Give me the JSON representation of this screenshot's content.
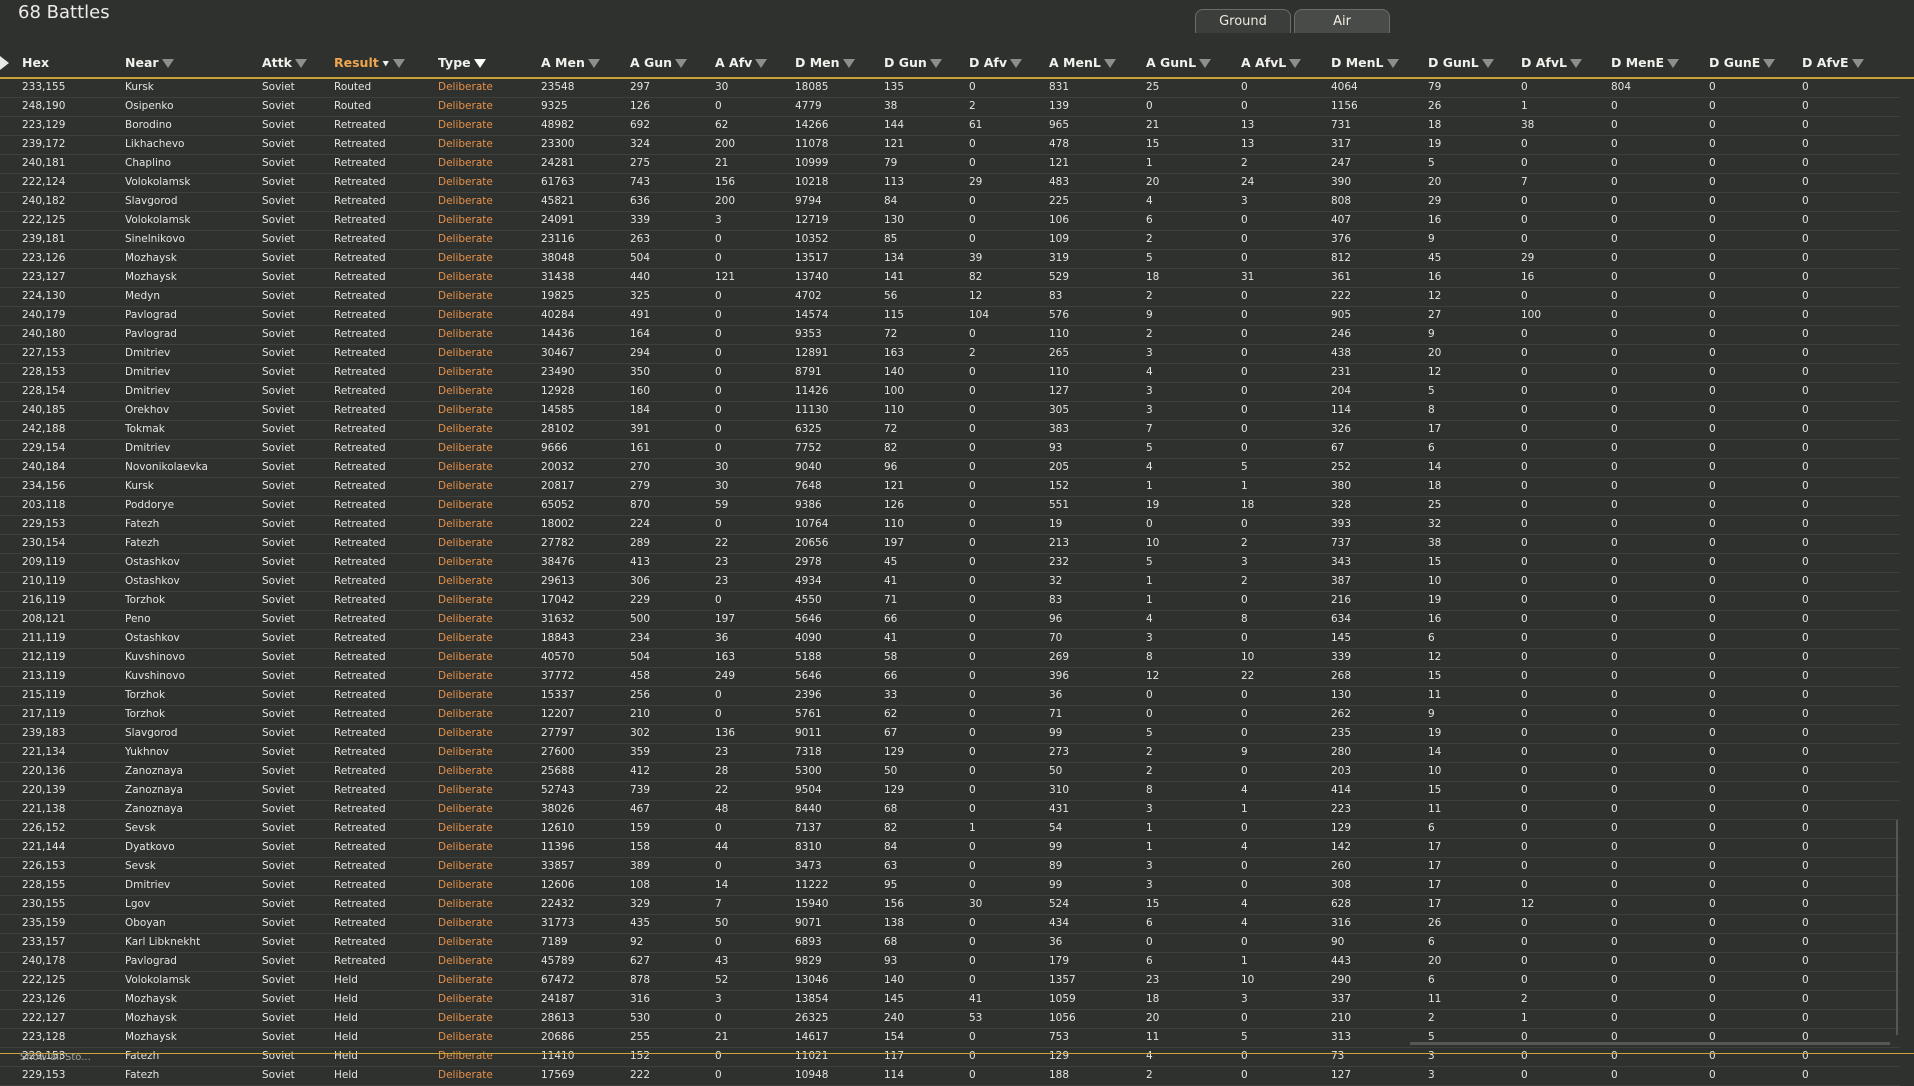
{
  "title": "68 Battles",
  "tabs": [
    "Ground",
    "Air"
  ],
  "footer": "Show all Sto...",
  "columns": [
    "Hex",
    "Near",
    "Attk",
    "Result",
    "Type",
    "A Men",
    "A Gun",
    "A Afv",
    "D Men",
    "D Gun",
    "D Afv",
    "A MenL",
    "A GunL",
    "A AfvL",
    "D MenL",
    "D GunL",
    "D AfvL",
    "D MenE",
    "D GunE",
    "D AfvE"
  ],
  "rows": [
    [
      "233,155",
      "Kursk",
      "Soviet",
      "Routed",
      "Deliberate",
      "23548",
      "297",
      "30",
      "18085",
      "135",
      "0",
      "831",
      "25",
      "0",
      "4064",
      "79",
      "0",
      "804",
      "0",
      "0"
    ],
    [
      "248,190",
      "Osipenko",
      "Soviet",
      "Routed",
      "Deliberate",
      "9325",
      "126",
      "0",
      "4779",
      "38",
      "2",
      "139",
      "0",
      "0",
      "1156",
      "26",
      "1",
      "0",
      "0",
      "0"
    ],
    [
      "223,129",
      "Borodino",
      "Soviet",
      "Retreated",
      "Deliberate",
      "48982",
      "692",
      "62",
      "14266",
      "144",
      "61",
      "965",
      "21",
      "13",
      "731",
      "18",
      "38",
      "0",
      "0",
      "0"
    ],
    [
      "239,172",
      "Likhachevo",
      "Soviet",
      "Retreated",
      "Deliberate",
      "23300",
      "324",
      "200",
      "11078",
      "121",
      "0",
      "478",
      "15",
      "13",
      "317",
      "19",
      "0",
      "0",
      "0",
      "0"
    ],
    [
      "240,181",
      "Chaplino",
      "Soviet",
      "Retreated",
      "Deliberate",
      "24281",
      "275",
      "21",
      "10999",
      "79",
      "0",
      "121",
      "1",
      "2",
      "247",
      "5",
      "0",
      "0",
      "0",
      "0"
    ],
    [
      "222,124",
      "Volokolamsk",
      "Soviet",
      "Retreated",
      "Deliberate",
      "61763",
      "743",
      "156",
      "10218",
      "113",
      "29",
      "483",
      "20",
      "24",
      "390",
      "20",
      "7",
      "0",
      "0",
      "0"
    ],
    [
      "240,182",
      "Slavgorod",
      "Soviet",
      "Retreated",
      "Deliberate",
      "45821",
      "636",
      "200",
      "9794",
      "84",
      "0",
      "225",
      "4",
      "3",
      "808",
      "29",
      "0",
      "0",
      "0",
      "0"
    ],
    [
      "222,125",
      "Volokolamsk",
      "Soviet",
      "Retreated",
      "Deliberate",
      "24091",
      "339",
      "3",
      "12719",
      "130",
      "0",
      "106",
      "6",
      "0",
      "407",
      "16",
      "0",
      "0",
      "0",
      "0"
    ],
    [
      "239,181",
      "Sinelnikovo",
      "Soviet",
      "Retreated",
      "Deliberate",
      "23116",
      "263",
      "0",
      "10352",
      "85",
      "0",
      "109",
      "2",
      "0",
      "376",
      "9",
      "0",
      "0",
      "0",
      "0"
    ],
    [
      "223,126",
      "Mozhaysk",
      "Soviet",
      "Retreated",
      "Deliberate",
      "38048",
      "504",
      "0",
      "13517",
      "134",
      "39",
      "319",
      "5",
      "0",
      "812",
      "45",
      "29",
      "0",
      "0",
      "0"
    ],
    [
      "223,127",
      "Mozhaysk",
      "Soviet",
      "Retreated",
      "Deliberate",
      "31438",
      "440",
      "121",
      "13740",
      "141",
      "82",
      "529",
      "18",
      "31",
      "361",
      "16",
      "16",
      "0",
      "0",
      "0"
    ],
    [
      "224,130",
      "Medyn",
      "Soviet",
      "Retreated",
      "Deliberate",
      "19825",
      "325",
      "0",
      "4702",
      "56",
      "12",
      "83",
      "2",
      "0",
      "222",
      "12",
      "0",
      "0",
      "0",
      "0"
    ],
    [
      "240,179",
      "Pavlograd",
      "Soviet",
      "Retreated",
      "Deliberate",
      "40284",
      "491",
      "0",
      "14574",
      "115",
      "104",
      "576",
      "9",
      "0",
      "905",
      "27",
      "100",
      "0",
      "0",
      "0"
    ],
    [
      "240,180",
      "Pavlograd",
      "Soviet",
      "Retreated",
      "Deliberate",
      "14436",
      "164",
      "0",
      "9353",
      "72",
      "0",
      "110",
      "2",
      "0",
      "246",
      "9",
      "0",
      "0",
      "0",
      "0"
    ],
    [
      "227,153",
      "Dmitriev",
      "Soviet",
      "Retreated",
      "Deliberate",
      "30467",
      "294",
      "0",
      "12891",
      "163",
      "2",
      "265",
      "3",
      "0",
      "438",
      "20",
      "0",
      "0",
      "0",
      "0"
    ],
    [
      "228,153",
      "Dmitriev",
      "Soviet",
      "Retreated",
      "Deliberate",
      "23490",
      "350",
      "0",
      "8791",
      "140",
      "0",
      "110",
      "4",
      "0",
      "231",
      "12",
      "0",
      "0",
      "0",
      "0"
    ],
    [
      "228,154",
      "Dmitriev",
      "Soviet",
      "Retreated",
      "Deliberate",
      "12928",
      "160",
      "0",
      "11426",
      "100",
      "0",
      "127",
      "3",
      "0",
      "204",
      "5",
      "0",
      "0",
      "0",
      "0"
    ],
    [
      "240,185",
      "Orekhov",
      "Soviet",
      "Retreated",
      "Deliberate",
      "14585",
      "184",
      "0",
      "11130",
      "110",
      "0",
      "305",
      "3",
      "0",
      "114",
      "8",
      "0",
      "0",
      "0",
      "0"
    ],
    [
      "242,188",
      "Tokmak",
      "Soviet",
      "Retreated",
      "Deliberate",
      "28102",
      "391",
      "0",
      "6325",
      "72",
      "0",
      "383",
      "7",
      "0",
      "326",
      "17",
      "0",
      "0",
      "0",
      "0"
    ],
    [
      "229,154",
      "Dmitriev",
      "Soviet",
      "Retreated",
      "Deliberate",
      "9666",
      "161",
      "0",
      "7752",
      "82",
      "0",
      "93",
      "5",
      "0",
      "67",
      "6",
      "0",
      "0",
      "0",
      "0"
    ],
    [
      "240,184",
      "Novonikolaevka",
      "Soviet",
      "Retreated",
      "Deliberate",
      "20032",
      "270",
      "30",
      "9040",
      "96",
      "0",
      "205",
      "4",
      "5",
      "252",
      "14",
      "0",
      "0",
      "0",
      "0"
    ],
    [
      "234,156",
      "Kursk",
      "Soviet",
      "Retreated",
      "Deliberate",
      "20817",
      "279",
      "30",
      "7648",
      "121",
      "0",
      "152",
      "1",
      "1",
      "380",
      "18",
      "0",
      "0",
      "0",
      "0"
    ],
    [
      "203,118",
      "Poddorye",
      "Soviet",
      "Retreated",
      "Deliberate",
      "65052",
      "870",
      "59",
      "9386",
      "126",
      "0",
      "551",
      "19",
      "18",
      "328",
      "25",
      "0",
      "0",
      "0",
      "0"
    ],
    [
      "229,153",
      "Fatezh",
      "Soviet",
      "Retreated",
      "Deliberate",
      "18002",
      "224",
      "0",
      "10764",
      "110",
      "0",
      "19",
      "0",
      "0",
      "393",
      "32",
      "0",
      "0",
      "0",
      "0"
    ],
    [
      "230,154",
      "Fatezh",
      "Soviet",
      "Retreated",
      "Deliberate",
      "27782",
      "289",
      "22",
      "20656",
      "197",
      "0",
      "213",
      "10",
      "2",
      "737",
      "38",
      "0",
      "0",
      "0",
      "0"
    ],
    [
      "209,119",
      "Ostashkov",
      "Soviet",
      "Retreated",
      "Deliberate",
      "38476",
      "413",
      "23",
      "2978",
      "45",
      "0",
      "232",
      "5",
      "3",
      "343",
      "15",
      "0",
      "0",
      "0",
      "0"
    ],
    [
      "210,119",
      "Ostashkov",
      "Soviet",
      "Retreated",
      "Deliberate",
      "29613",
      "306",
      "23",
      "4934",
      "41",
      "0",
      "32",
      "1",
      "2",
      "387",
      "10",
      "0",
      "0",
      "0",
      "0"
    ],
    [
      "216,119",
      "Torzhok",
      "Soviet",
      "Retreated",
      "Deliberate",
      "17042",
      "229",
      "0",
      "4550",
      "71",
      "0",
      "83",
      "1",
      "0",
      "216",
      "19",
      "0",
      "0",
      "0",
      "0"
    ],
    [
      "208,121",
      "Peno",
      "Soviet",
      "Retreated",
      "Deliberate",
      "31632",
      "500",
      "197",
      "5646",
      "66",
      "0",
      "96",
      "4",
      "8",
      "634",
      "16",
      "0",
      "0",
      "0",
      "0"
    ],
    [
      "211,119",
      "Ostashkov",
      "Soviet",
      "Retreated",
      "Deliberate",
      "18843",
      "234",
      "36",
      "4090",
      "41",
      "0",
      "70",
      "3",
      "0",
      "145",
      "6",
      "0",
      "0",
      "0",
      "0"
    ],
    [
      "212,119",
      "Kuvshinovo",
      "Soviet",
      "Retreated",
      "Deliberate",
      "40570",
      "504",
      "163",
      "5188",
      "58",
      "0",
      "269",
      "8",
      "10",
      "339",
      "12",
      "0",
      "0",
      "0",
      "0"
    ],
    [
      "213,119",
      "Kuvshinovo",
      "Soviet",
      "Retreated",
      "Deliberate",
      "37772",
      "458",
      "249",
      "5646",
      "66",
      "0",
      "396",
      "12",
      "22",
      "268",
      "15",
      "0",
      "0",
      "0",
      "0"
    ],
    [
      "215,119",
      "Torzhok",
      "Soviet",
      "Retreated",
      "Deliberate",
      "15337",
      "256",
      "0",
      "2396",
      "33",
      "0",
      "36",
      "0",
      "0",
      "130",
      "11",
      "0",
      "0",
      "0",
      "0"
    ],
    [
      "217,119",
      "Torzhok",
      "Soviet",
      "Retreated",
      "Deliberate",
      "12207",
      "210",
      "0",
      "5761",
      "62",
      "0",
      "71",
      "0",
      "0",
      "262",
      "9",
      "0",
      "0",
      "0",
      "0"
    ],
    [
      "239,183",
      "Slavgorod",
      "Soviet",
      "Retreated",
      "Deliberate",
      "27797",
      "302",
      "136",
      "9011",
      "67",
      "0",
      "99",
      "5",
      "0",
      "235",
      "19",
      "0",
      "0",
      "0",
      "0"
    ],
    [
      "221,134",
      "Yukhnov",
      "Soviet",
      "Retreated",
      "Deliberate",
      "27600",
      "359",
      "23",
      "7318",
      "129",
      "0",
      "273",
      "2",
      "9",
      "280",
      "14",
      "0",
      "0",
      "0",
      "0"
    ],
    [
      "220,136",
      "Zanoznaya",
      "Soviet",
      "Retreated",
      "Deliberate",
      "25688",
      "412",
      "28",
      "5300",
      "50",
      "0",
      "50",
      "2",
      "0",
      "203",
      "10",
      "0",
      "0",
      "0",
      "0"
    ],
    [
      "220,139",
      "Zanoznaya",
      "Soviet",
      "Retreated",
      "Deliberate",
      "52743",
      "739",
      "22",
      "9504",
      "129",
      "0",
      "310",
      "8",
      "4",
      "414",
      "15",
      "0",
      "0",
      "0",
      "0"
    ],
    [
      "221,138",
      "Zanoznaya",
      "Soviet",
      "Retreated",
      "Deliberate",
      "38026",
      "467",
      "48",
      "8440",
      "68",
      "0",
      "431",
      "3",
      "1",
      "223",
      "11",
      "0",
      "0",
      "0",
      "0"
    ],
    [
      "226,152",
      "Sevsk",
      "Soviet",
      "Retreated",
      "Deliberate",
      "12610",
      "159",
      "0",
      "7137",
      "82",
      "1",
      "54",
      "1",
      "0",
      "129",
      "6",
      "0",
      "0",
      "0",
      "0"
    ],
    [
      "221,144",
      "Dyatkovo",
      "Soviet",
      "Retreated",
      "Deliberate",
      "11396",
      "158",
      "44",
      "8310",
      "84",
      "0",
      "99",
      "1",
      "4",
      "142",
      "17",
      "0",
      "0",
      "0",
      "0"
    ],
    [
      "226,153",
      "Sevsk",
      "Soviet",
      "Retreated",
      "Deliberate",
      "33857",
      "389",
      "0",
      "3473",
      "63",
      "0",
      "89",
      "3",
      "0",
      "260",
      "17",
      "0",
      "0",
      "0",
      "0"
    ],
    [
      "228,155",
      "Dmitriev",
      "Soviet",
      "Retreated",
      "Deliberate",
      "12606",
      "108",
      "14",
      "11222",
      "95",
      "0",
      "99",
      "3",
      "0",
      "308",
      "17",
      "0",
      "0",
      "0",
      "0"
    ],
    [
      "230,155",
      "Lgov",
      "Soviet",
      "Retreated",
      "Deliberate",
      "22432",
      "329",
      "7",
      "15940",
      "156",
      "30",
      "524",
      "15",
      "4",
      "628",
      "17",
      "12",
      "0",
      "0",
      "0"
    ],
    [
      "235,159",
      "Oboyan",
      "Soviet",
      "Retreated",
      "Deliberate",
      "31773",
      "435",
      "50",
      "9071",
      "138",
      "0",
      "434",
      "6",
      "4",
      "316",
      "26",
      "0",
      "0",
      "0",
      "0"
    ],
    [
      "233,157",
      "Karl Libknekht",
      "Soviet",
      "Retreated",
      "Deliberate",
      "7189",
      "92",
      "0",
      "6893",
      "68",
      "0",
      "36",
      "0",
      "0",
      "90",
      "6",
      "0",
      "0",
      "0",
      "0"
    ],
    [
      "240,178",
      "Pavlograd",
      "Soviet",
      "Retreated",
      "Deliberate",
      "45789",
      "627",
      "43",
      "9829",
      "93",
      "0",
      "179",
      "6",
      "1",
      "443",
      "20",
      "0",
      "0",
      "0",
      "0"
    ],
    [
      "222,125",
      "Volokolamsk",
      "Soviet",
      "Held",
      "Deliberate",
      "67472",
      "878",
      "52",
      "13046",
      "140",
      "0",
      "1357",
      "23",
      "10",
      "290",
      "6",
      "0",
      "0",
      "0",
      "0"
    ],
    [
      "223,126",
      "Mozhaysk",
      "Soviet",
      "Held",
      "Deliberate",
      "24187",
      "316",
      "3",
      "13854",
      "145",
      "41",
      "1059",
      "18",
      "3",
      "337",
      "11",
      "2",
      "0",
      "0",
      "0"
    ],
    [
      "222,127",
      "Mozhaysk",
      "Soviet",
      "Held",
      "Deliberate",
      "28613",
      "530",
      "0",
      "26325",
      "240",
      "53",
      "1056",
      "20",
      "0",
      "210",
      "2",
      "1",
      "0",
      "0",
      "0"
    ],
    [
      "223,128",
      "Mozhaysk",
      "Soviet",
      "Held",
      "Deliberate",
      "20686",
      "255",
      "21",
      "14617",
      "154",
      "0",
      "753",
      "11",
      "5",
      "313",
      "5",
      "0",
      "0",
      "0",
      "0"
    ],
    [
      "229,153",
      "Fatezh",
      "Soviet",
      "Held",
      "Deliberate",
      "11410",
      "152",
      "0",
      "11021",
      "117",
      "0",
      "129",
      "4",
      "0",
      "73",
      "3",
      "0",
      "0",
      "0",
      "0"
    ],
    [
      "229,153",
      "Fatezh",
      "Soviet",
      "Held",
      "Deliberate",
      "17569",
      "222",
      "0",
      "10948",
      "114",
      "0",
      "188",
      "2",
      "0",
      "127",
      "3",
      "0",
      "0",
      "0",
      "0"
    ]
  ]
}
